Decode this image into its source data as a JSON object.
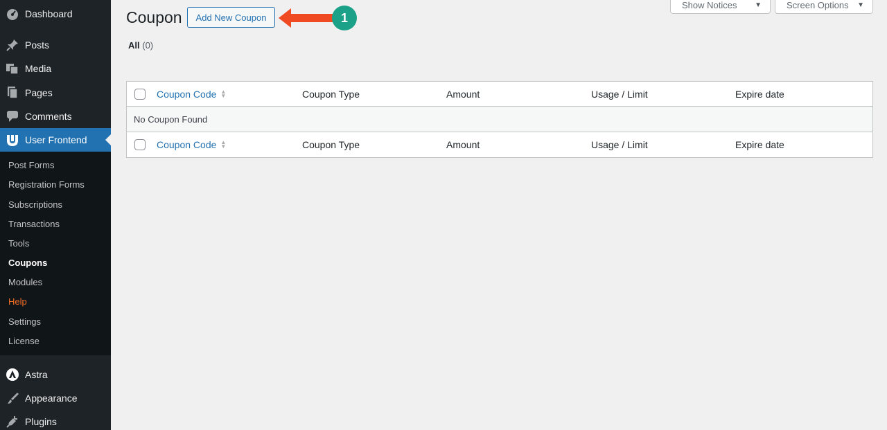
{
  "sidebar": {
    "items": [
      {
        "label": "Dashboard",
        "icon": "dashboard-icon"
      },
      {
        "label": "Posts",
        "icon": "pin-icon"
      },
      {
        "label": "Media",
        "icon": "media-icon"
      },
      {
        "label": "Pages",
        "icon": "pages-icon"
      },
      {
        "label": "Comments",
        "icon": "comment-icon"
      },
      {
        "label": "User Frontend",
        "icon": "user-frontend-icon",
        "active": true
      },
      {
        "label": "Astra",
        "icon": "astra-icon"
      },
      {
        "label": "Appearance",
        "icon": "brush-icon"
      },
      {
        "label": "Plugins",
        "icon": "plug-icon"
      }
    ],
    "submenu": [
      {
        "label": "Post Forms"
      },
      {
        "label": "Registration Forms"
      },
      {
        "label": "Subscriptions"
      },
      {
        "label": "Transactions"
      },
      {
        "label": "Tools"
      },
      {
        "label": "Coupons",
        "current": true
      },
      {
        "label": "Modules"
      },
      {
        "label": "Help",
        "highlight": true
      },
      {
        "label": "Settings"
      },
      {
        "label": "License"
      }
    ]
  },
  "top_buttons": {
    "show_notices": "Show Notices",
    "screen_options": "Screen Options"
  },
  "page": {
    "title": "Coupon",
    "add_new_label": "Add New Coupon",
    "annotation_number": "1",
    "filter_all_label": "All",
    "filter_all_count": "(0)"
  },
  "table": {
    "columns": [
      "Coupon Code",
      "Coupon Type",
      "Amount",
      "Usage / Limit",
      "Expire date"
    ],
    "empty_message": "No Coupon Found"
  },
  "colors": {
    "sidebar_bg": "#1d2327",
    "accent": "#2271b1",
    "annotation_arrow": "#f04a23",
    "annotation_badge": "#1aa187",
    "help": "#f56e28"
  }
}
